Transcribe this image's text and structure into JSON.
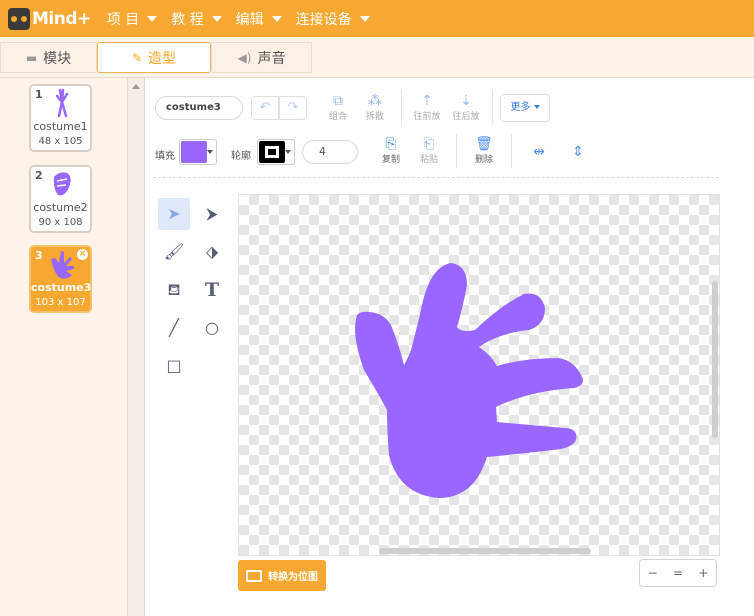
{
  "app": {
    "logo_text": "Mind+"
  },
  "menu": [
    {
      "label": "项 目"
    },
    {
      "label": "教 程"
    },
    {
      "label": "编辑"
    },
    {
      "label": "连接设备"
    }
  ],
  "tabs": [
    {
      "label": "模块",
      "icon": "blocks-icon"
    },
    {
      "label": "造型",
      "icon": "brush-icon",
      "active": true
    },
    {
      "label": "声音",
      "icon": "speaker-icon"
    }
  ],
  "costumes": [
    {
      "number": "1",
      "name": "costume1",
      "size": "48 x 105"
    },
    {
      "number": "2",
      "name": "costume2",
      "size": "90 x 108"
    },
    {
      "number": "3",
      "name": "costume3",
      "size": "103 x 107",
      "selected": true
    }
  ],
  "editor": {
    "costume_name": "costume3",
    "undo": "↶",
    "redo": "↷",
    "group_label": "组合",
    "ungroup_label": "拆散",
    "forward_label": "往前放",
    "backward_label": "往后放",
    "more_label": "更多",
    "fill_label": "填充",
    "outline_label": "轮廓",
    "outline_width": "4",
    "copy_label": "复制",
    "paste_label": "粘贴",
    "delete_label": "删除",
    "convert_label": "转换为位图",
    "zoom_out": "−",
    "zoom_reset": "=",
    "zoom_in": "+"
  },
  "colors": {
    "accent": "#f7a833",
    "fill": "#9966ff",
    "outline": "#000000",
    "tool_blue": "#4e8ef0"
  }
}
